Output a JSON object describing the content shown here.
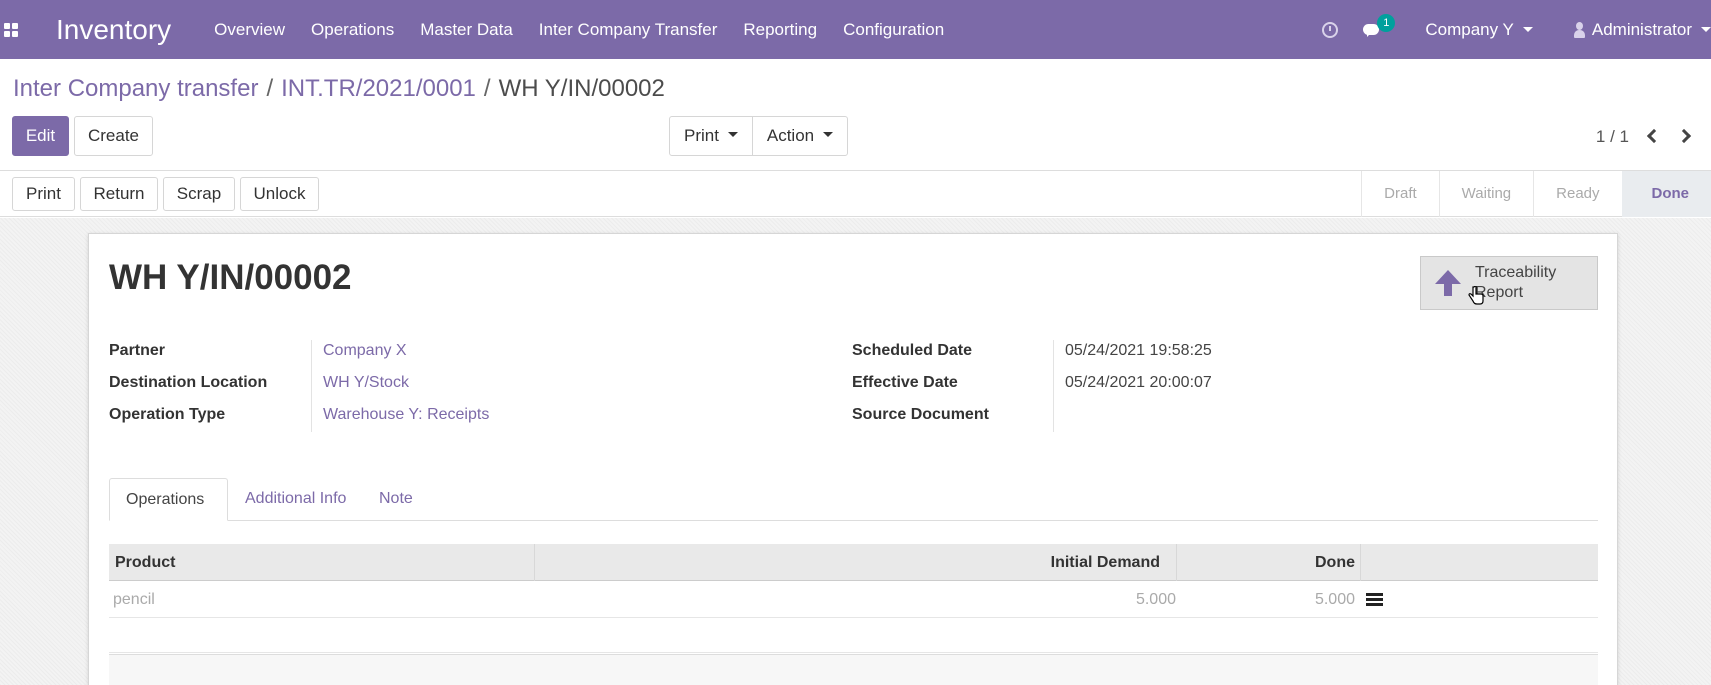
{
  "app": {
    "title": "Inventory",
    "menu": [
      "Overview",
      "Operations",
      "Master Data",
      "Inter Company Transfer",
      "Reporting",
      "Configuration"
    ],
    "chat_badge": "1",
    "company": "Company Y",
    "user": "Administrator",
    "accent": "#7c6aa8"
  },
  "breadcrumb": {
    "items": [
      "Inter Company transfer",
      "INT.TR/2021/0001"
    ],
    "separator": "/",
    "current": "WH Y/IN/00002"
  },
  "controls": {
    "edit": "Edit",
    "create": "Create",
    "print": "Print",
    "action": "Action",
    "pager": "1 / 1"
  },
  "statusbar": {
    "buttons": [
      "Print",
      "Return",
      "Scrap",
      "Unlock"
    ],
    "stages": [
      "Draft",
      "Waiting",
      "Ready",
      "Done"
    ],
    "active_stage": "Done"
  },
  "record": {
    "title": "WH Y/IN/00002",
    "smart_button": "Traceability Report",
    "left_fields": [
      {
        "label": "Partner",
        "value": "Company X"
      },
      {
        "label": "Destination Location",
        "value": "WH Y/Stock"
      },
      {
        "label": "Operation Type",
        "value": "Warehouse Y: Receipts"
      }
    ],
    "right_fields": [
      {
        "label": "Scheduled Date",
        "value": "05/24/2021 19:58:25"
      },
      {
        "label": "Effective Date",
        "value": "05/24/2021 20:00:07"
      },
      {
        "label": "Source Document",
        "value": ""
      }
    ]
  },
  "tabs": [
    "Operations",
    "Additional Info",
    "Note"
  ],
  "table": {
    "columns": [
      "Product",
      "Initial Demand",
      "Done"
    ],
    "rows": [
      {
        "product": "pencil",
        "initial_demand": "5.000",
        "done": "5.000"
      }
    ]
  }
}
